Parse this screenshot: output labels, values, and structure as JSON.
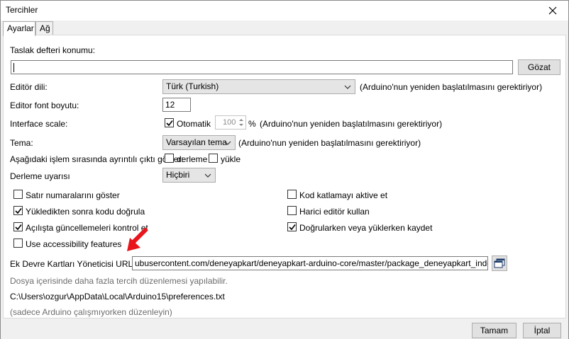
{
  "window": {
    "title": "Tercihler"
  },
  "tabs": [
    {
      "label": "Ayarlar"
    },
    {
      "label": "Ağ"
    }
  ],
  "settings": {
    "sketchbook": {
      "label": "Taslak defteri konumu:",
      "value": "",
      "browse_label": "Gözat"
    },
    "editor_language": {
      "label": "Editör dili:",
      "value": "Türk (Turkish)",
      "note": "(Arduino'nun yeniden başlatılmasını gerektiriyor)"
    },
    "editor_font_size": {
      "label": "Editor font boyutu:",
      "value": "12"
    },
    "interface_scale": {
      "label": "Interface scale:",
      "auto_label": "Otomatik",
      "auto_checked": true,
      "value": "100",
      "unit": "%",
      "note": "(Arduino'nun yeniden başlatılmasını gerektiriyor)"
    },
    "theme": {
      "label": "Tema:",
      "value": "Varsayılan tema",
      "note": "(Arduino'nun yeniden başlatılmasını gerektiriyor)"
    },
    "verbose_output": {
      "label": "Aşağıdaki işlem sırasında ayrıntılı çıktı göster:",
      "compile_label": "derleme",
      "compile_checked": false,
      "upload_label": "yükle",
      "upload_checked": false
    },
    "compiler_warnings": {
      "label": "Derleme uyarısı",
      "value": "Hiçbiri"
    },
    "options_left": [
      {
        "label": "Satır numaralarını göster",
        "checked": false
      },
      {
        "label": "Yükledikten sonra kodu doğrula",
        "checked": true
      },
      {
        "label": "Açılışta güncellemeleri kontrol et",
        "checked": true
      },
      {
        "label": "Use accessibility features",
        "checked": false
      }
    ],
    "options_right": [
      {
        "label": "Kod katlamayı aktive et",
        "checked": false
      },
      {
        "label": "Harici editör kullan",
        "checked": false
      },
      {
        "label": "Doğrularken veya yüklerken kaydet",
        "checked": true
      }
    ],
    "board_urls": {
      "label": "Ek Devre Kartları Yöneticisi URL'leri:",
      "value": "ubusercontent.com/deneyapkart/deneyapkart-arduino-core/master/package_deneyapkart_index.json"
    },
    "more_prefs_note": "Dosya içerisinde daha fazla tercih düzenlemesi yapılabilir.",
    "prefs_path": "C:\\Users\\ozgur\\AppData\\Local\\Arduino15\\preferences.txt",
    "edit_note": "(sadece Arduino çalışmıyorken düzenleyin)"
  },
  "footer": {
    "ok_label": "Tamam",
    "cancel_label": "İptal"
  },
  "colors": {
    "annotation_arrow": "#e8161c",
    "checkbox_border": "#333333",
    "panel_bg": "#ffffff",
    "window_bg": "#f0f0f0"
  }
}
